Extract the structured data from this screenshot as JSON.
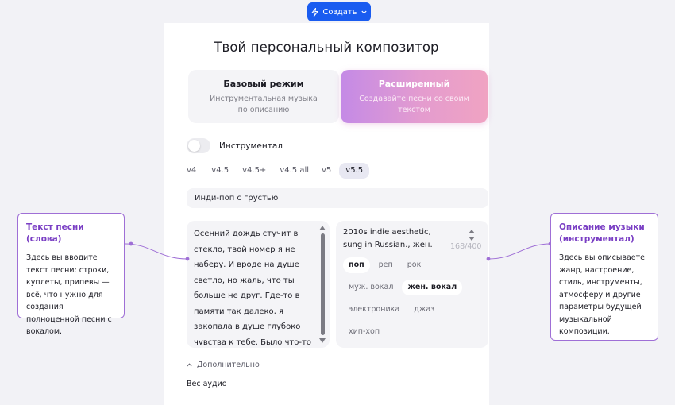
{
  "top_button": {
    "label": "Создать"
  },
  "header": {
    "title": "Твой персональный композитор"
  },
  "modes": {
    "basic": {
      "title": "Базовый режим",
      "subtitle": "Инструментальная музыка по описанию"
    },
    "extended": {
      "title": "Расширенный",
      "subtitle": "Создавайте песни со своим текстом"
    }
  },
  "instrumental_toggle": {
    "label": "Инструментал",
    "on": false
  },
  "versions": [
    "v4",
    "v4.5",
    "v4.5+",
    "v4.5 all",
    "v5",
    "v5.5"
  ],
  "selected_version": "v5.5",
  "style_input": {
    "value": "Инди-поп с грустью"
  },
  "lyrics": {
    "value": "Осенний дождь стучит в стекло, твой номер я не наберу. И вроде на душе светло, но жаль, что ты больше не друг. Где-то в памяти так далеко, я закопала в душе глубоко чувства к тебе. Было что-то так давно, но тебя уже не видно мне."
  },
  "description": {
    "value": "2010s indie aesthetic, sung in Russian., жен.",
    "counter": "168/400",
    "tags": [
      [
        {
          "label": "поп",
          "selected": true
        },
        {
          "label": "реп",
          "selected": false
        },
        {
          "label": "рок",
          "selected": false
        }
      ],
      [
        {
          "label": "муж. вокал",
          "selected": false
        },
        {
          "label": "жен. вокал",
          "selected": true
        }
      ],
      [
        {
          "label": "электроника",
          "selected": false
        },
        {
          "label": "джаз",
          "selected": false
        }
      ],
      [
        {
          "label": "хип-хоп",
          "selected": false
        }
      ]
    ]
  },
  "more_label": "Дополнительно",
  "audio_weight_label": "Вес аудио",
  "callouts": {
    "left": {
      "title": "Текст песни (слова)",
      "body": "Здесь вы вводите текст песни: строки, куплеты, припевы — всё, что нужно для создания полноценной песни с вокалом."
    },
    "right": {
      "title": "Описание музыки (инструментал)",
      "body": "Здесь вы описываете жанр, настроение, стиль, инструменты, атмосферу и другие параметры будущей музыкальной композиции."
    }
  },
  "colors": {
    "accent": "#1a5cf0",
    "callout_border": "#9f6fd6",
    "callout_title": "#7a3fc4",
    "extended_gradient_start": "#c48ae6",
    "extended_gradient_end": "#f0a3c2"
  },
  "icons": {
    "top_button": "lightning-icon",
    "top_button_caret": "chevron-down-icon",
    "more": "chevron-up-icon"
  }
}
